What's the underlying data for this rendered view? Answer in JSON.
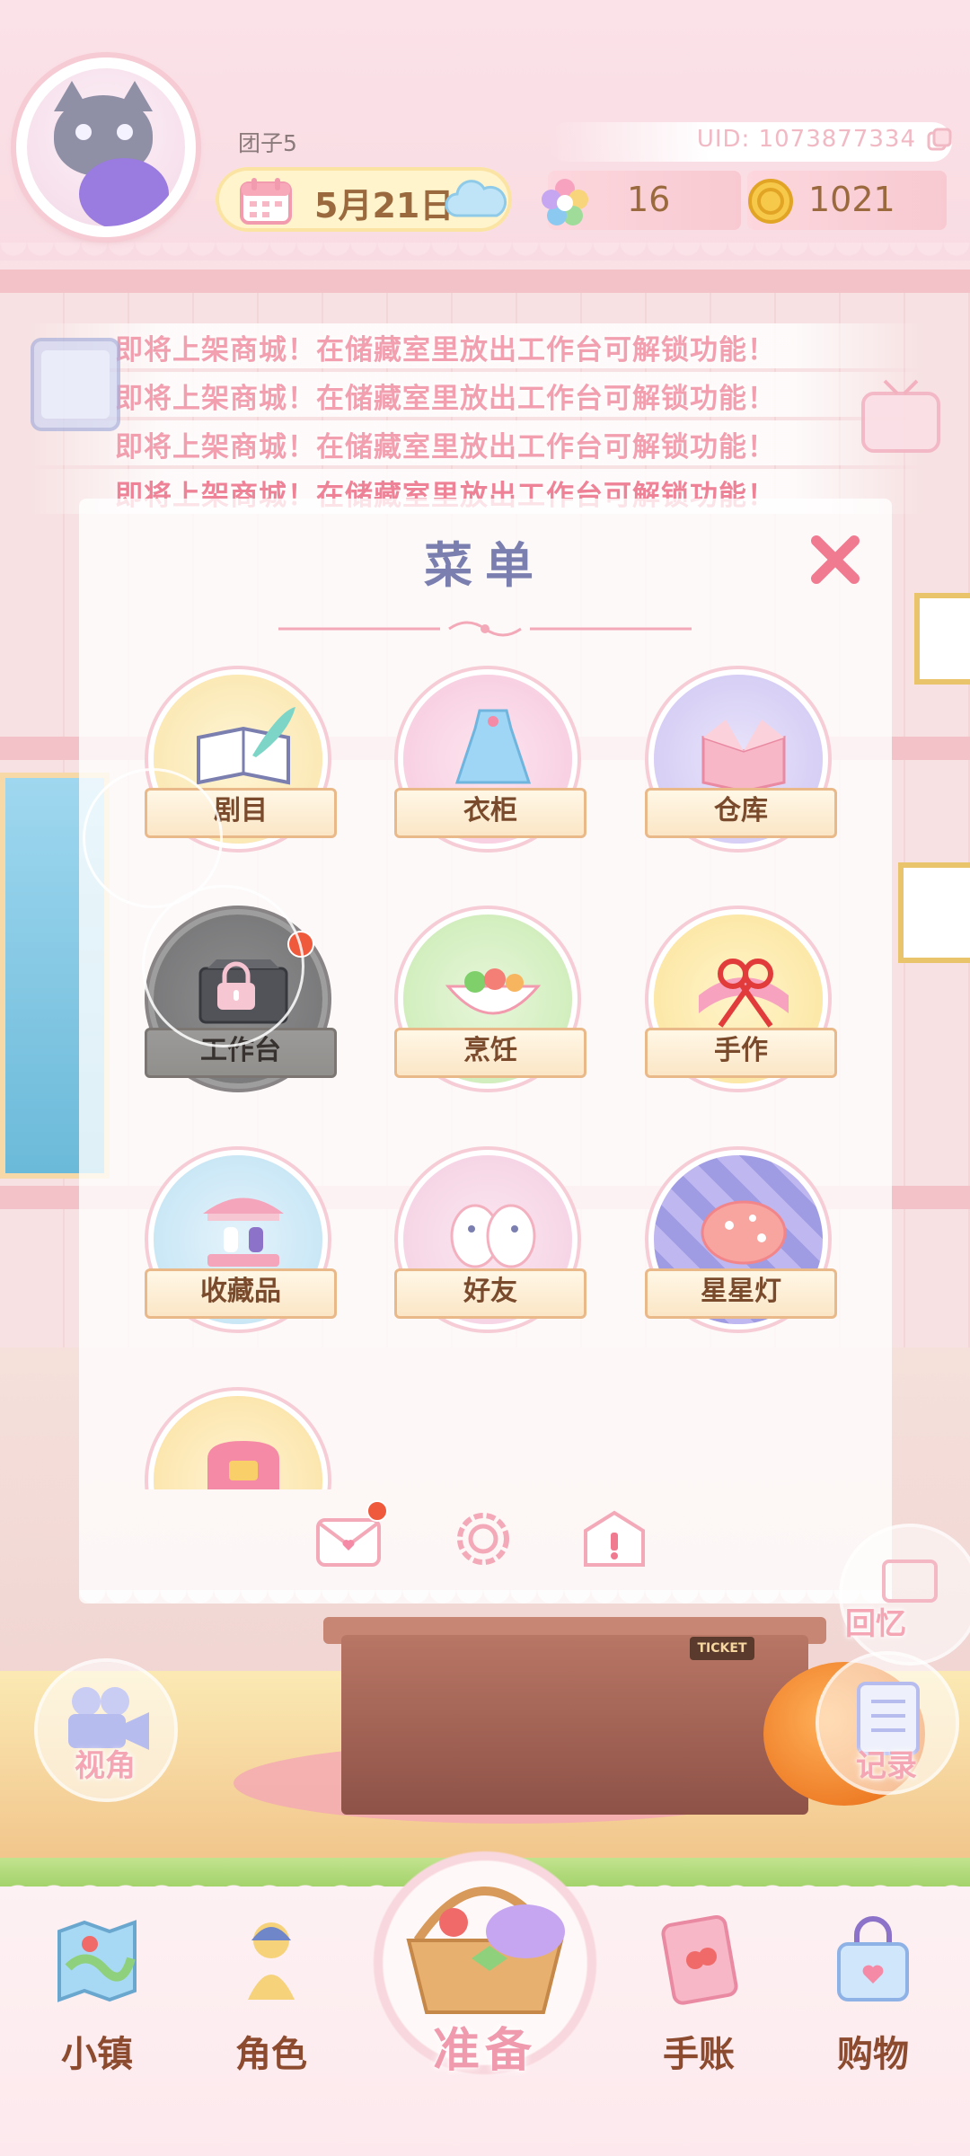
{
  "header": {
    "username": "团子5",
    "uid": "UID: 1073877334",
    "date": "5月21日",
    "weather_icon": "cloud-icon",
    "gems": "16",
    "coins": "1021"
  },
  "announcement": {
    "text": "即将上架商城！在储藏室里放出工作台可解锁功能！"
  },
  "menu": {
    "title": "菜单",
    "items": [
      {
        "label": "剧目",
        "icon": "book-quill-icon",
        "locked": false
      },
      {
        "label": "衣柜",
        "icon": "dress-icon",
        "locked": false
      },
      {
        "label": "仓库",
        "icon": "storage-box-icon",
        "locked": false
      },
      {
        "label": "工作台",
        "icon": "workbench-icon",
        "locked": true
      },
      {
        "label": "烹饪",
        "icon": "cooking-pot-icon",
        "locked": false
      },
      {
        "label": "手作",
        "icon": "scissors-icon",
        "locked": false
      },
      {
        "label": "收藏品",
        "icon": "carousel-icon",
        "locked": false
      },
      {
        "label": "好友",
        "icon": "friends-icon",
        "locked": false
      },
      {
        "label": "星星灯",
        "icon": "star-lamp-icon",
        "locked": false
      },
      {
        "label": "",
        "icon": "sofa-icon",
        "locked": false
      }
    ],
    "tools": [
      "mail-icon",
      "settings-icon",
      "notice-icon"
    ]
  },
  "side": {
    "camera_label": "视角",
    "memory_label": "回忆",
    "record_label": "记录",
    "ticket_label": "TICKET"
  },
  "nav": {
    "town": "小镇",
    "character": "角色",
    "prepare": "准备",
    "notebook": "手账",
    "shopping": "购物"
  },
  "colors": {
    "accent_pink": "#ee8297",
    "title_blue": "#7a7fb0",
    "label_brown": "#7a4a2c"
  }
}
